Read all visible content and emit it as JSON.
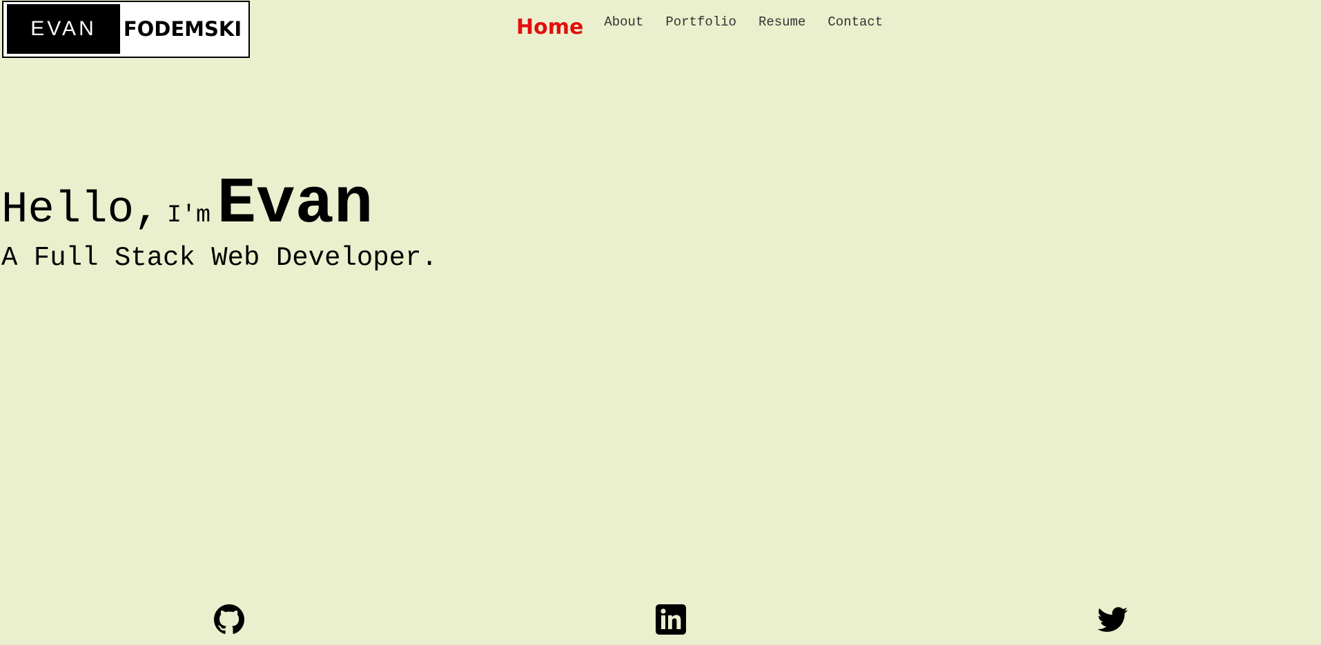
{
  "logo": {
    "first": "EVAN",
    "last": "FODEMSKI"
  },
  "nav": {
    "home": "Home",
    "items": [
      "About",
      "Portfolio",
      "Resume",
      "Contact"
    ]
  },
  "hero": {
    "hello": "Hello,",
    "im": "I'm",
    "name": "Evan",
    "subtitle": "A Full Stack Web Developer."
  },
  "social": {
    "icons": [
      "github-icon",
      "linkedin-icon",
      "twitter-icon"
    ]
  },
  "colors": {
    "background": "#eaf0cd",
    "active_nav": "#e30f0f",
    "text": "#000000"
  }
}
